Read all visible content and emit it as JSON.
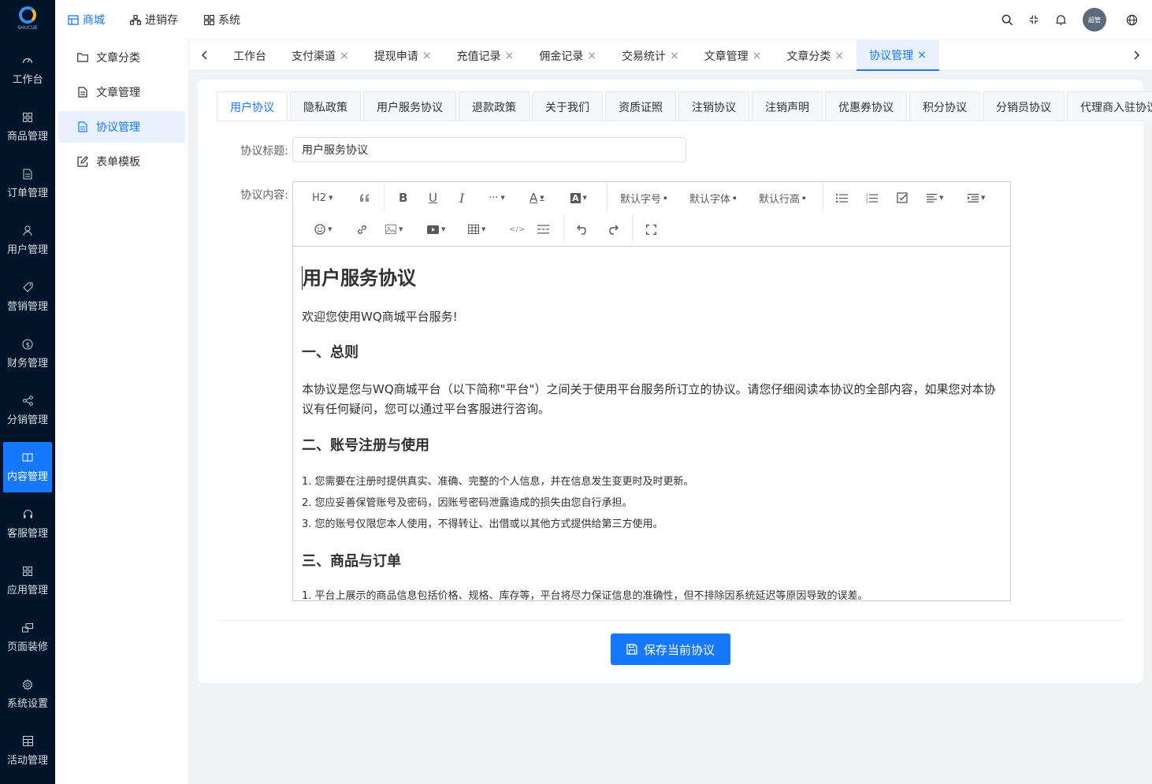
{
  "logo": {
    "text": "SHUCUE"
  },
  "rail": {
    "items": [
      {
        "label": "工作台",
        "icon": "dashboard-icon"
      },
      {
        "label": "商品管理",
        "icon": "grid-icon"
      },
      {
        "label": "订单管理",
        "icon": "document-icon"
      },
      {
        "label": "用户管理",
        "icon": "user-icon"
      },
      {
        "label": "营销管理",
        "icon": "tag-icon"
      },
      {
        "label": "财务管理",
        "icon": "dollar-icon"
      },
      {
        "label": "分销管理",
        "icon": "share-icon"
      },
      {
        "label": "内容管理",
        "icon": "book-icon"
      },
      {
        "label": "客服管理",
        "icon": "headset-icon"
      },
      {
        "label": "应用管理",
        "icon": "apps-icon"
      },
      {
        "label": "页面装修",
        "icon": "layout-icon"
      },
      {
        "label": "系统设置",
        "icon": "gear-icon"
      },
      {
        "label": "活动管理",
        "icon": "calendar-icon"
      }
    ],
    "active_index": 7
  },
  "topnav": {
    "items": [
      {
        "label": "商城",
        "icon": "store-icon"
      },
      {
        "label": "进销存",
        "icon": "inventory-icon"
      },
      {
        "label": "系统",
        "icon": "system-icon"
      }
    ],
    "active_index": 0
  },
  "header": {
    "avatar_text": "超管"
  },
  "submenu": {
    "items": [
      {
        "label": "文章分类",
        "icon": "folder-icon"
      },
      {
        "label": "文章管理",
        "icon": "file-icon"
      },
      {
        "label": "协议管理",
        "icon": "file-icon"
      },
      {
        "label": "表单模板",
        "icon": "edit-icon"
      }
    ],
    "active_index": 2
  },
  "tabs": {
    "items": [
      {
        "label": "工作台",
        "closable": false
      },
      {
        "label": "支付渠道",
        "closable": true
      },
      {
        "label": "提现申请",
        "closable": true
      },
      {
        "label": "充值记录",
        "closable": true
      },
      {
        "label": "佣金记录",
        "closable": true
      },
      {
        "label": "交易统计",
        "closable": true
      },
      {
        "label": "文章管理",
        "closable": true
      },
      {
        "label": "文章分类",
        "closable": true
      },
      {
        "label": "协议管理",
        "closable": true
      }
    ],
    "active_index": 8,
    "close_glyph": "×"
  },
  "protocol_tabs": {
    "items": [
      "用户协议",
      "隐私政策",
      "用户服务协议",
      "退款政策",
      "关于我们",
      "资质证照",
      "注销协议",
      "注销声明",
      "优惠券协议",
      "积分协议",
      "分销员协议",
      "代理商入驻协议"
    ],
    "active_index": 0
  },
  "form": {
    "title_label": "协议标题:",
    "title_value": "用户服务协议",
    "content_label": "协议内容:"
  },
  "toolbar": {
    "heading": "H2",
    "font_size": "默认字号",
    "font_family": "默认字体",
    "line_height": "默认行高"
  },
  "document": {
    "title": "用户服务协议",
    "welcome": "欢迎您使用WQ商城平台服务!",
    "s1_heading": "一、总则",
    "s1_body": "本协议是您与WQ商城平台（以下简称\"平台\"）之间关于使用平台服务所订立的协议。请您仔细阅读本协议的全部内容，如果您对本协议有任何疑问，您可以通过平台客服进行咨询。",
    "s2_heading": "二、账号注册与使用",
    "s2_items": [
      "1. 您需要在注册时提供真实、准确、完整的个人信息，并在信息发生变更时及时更新。",
      "2. 您应妥善保管账号及密码，因账号密码泄露造成的损失由您自行承担。",
      "3. 您的账号仅限您本人使用，不得转让、出借或以其他方式提供给第三方使用。"
    ],
    "s3_heading": "三、商品与订单",
    "s3_items": [
      "1. 平台上展示的商品信息包括价格、规格、库存等，平台将尽力保证信息的准确性，但不排除因系统延迟等原因导致的误差。"
    ]
  },
  "save_button": {
    "label": "保存当前协议"
  },
  "colors": {
    "primary": "#1677ff",
    "sidebar": "#001529"
  }
}
